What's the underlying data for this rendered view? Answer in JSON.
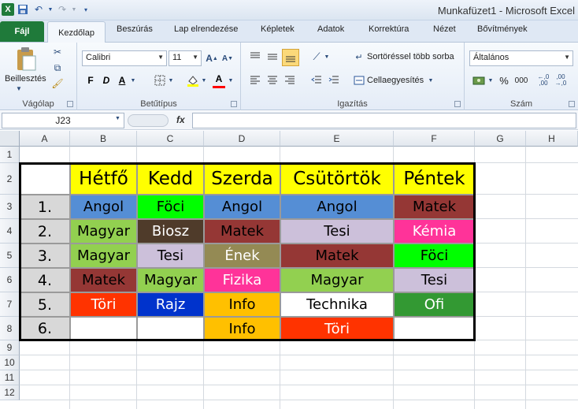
{
  "window": {
    "title": "Munkafüzet1  -  Microsoft Excel"
  },
  "tabs": [
    "Fájl",
    "Kezdőlap",
    "Beszúrás",
    "Lap elrendezése",
    "Képletek",
    "Adatok",
    "Korrektúra",
    "Nézet",
    "Bővítmények"
  ],
  "ribbon": {
    "clipboard": {
      "paste_label": "Beillesztés",
      "group_label": "Vágólap"
    },
    "font": {
      "font_name": "Calibri",
      "font_size": "11",
      "group_label": "Betűtípus",
      "bold": "F",
      "italic": "D",
      "underline": "A"
    },
    "alignment": {
      "wrap_label": "Sortöréssel több sorba",
      "merge_label": "Cellaegyesítés",
      "group_label": "Igazítás"
    },
    "number": {
      "format": "Általános",
      "percent": "%",
      "thousands": "000",
      "group_label": "Szám"
    }
  },
  "formula_bar": {
    "name_box": "J23",
    "fx": "fx",
    "value": ""
  },
  "columns": [
    "A",
    "B",
    "C",
    "D",
    "E",
    "F",
    "G",
    "H"
  ],
  "rows": [
    "1",
    "2",
    "3",
    "4",
    "5",
    "6",
    "7",
    "8",
    "9",
    "10",
    "11",
    "12"
  ],
  "timetable": {
    "days": [
      "Hétfő",
      "Kedd",
      "Szerda",
      "Csütörtök",
      "Péntek"
    ],
    "periods": [
      "1.",
      "2.",
      "3.",
      "4.",
      "5.",
      "6."
    ],
    "cells": [
      [
        {
          "t": "Angol",
          "bg": "#558ed5",
          "fg": "#000"
        },
        {
          "t": "Föci",
          "bg": "#00ff00",
          "fg": "#000"
        },
        {
          "t": "Angol",
          "bg": "#558ed5",
          "fg": "#000"
        },
        {
          "t": "Angol",
          "bg": "#558ed5",
          "fg": "#000"
        },
        {
          "t": "Matek",
          "bg": "#953735",
          "fg": "#000"
        }
      ],
      [
        {
          "t": "Magyar",
          "bg": "#92d050",
          "fg": "#000"
        },
        {
          "t": "Biosz",
          "bg": "#4f3b2a",
          "fg": "#fff"
        },
        {
          "t": "Matek",
          "bg": "#953735",
          "fg": "#000"
        },
        {
          "t": "Tesi",
          "bg": "#ccc0da",
          "fg": "#000"
        },
        {
          "t": "Kémia",
          "bg": "#ff3399",
          "fg": "#fff"
        }
      ],
      [
        {
          "t": "Magyar",
          "bg": "#92d050",
          "fg": "#000"
        },
        {
          "t": "Tesi",
          "bg": "#ccc0da",
          "fg": "#000"
        },
        {
          "t": "Ének",
          "bg": "#948a54",
          "fg": "#fff"
        },
        {
          "t": "Matek",
          "bg": "#953735",
          "fg": "#000"
        },
        {
          "t": "Föci",
          "bg": "#00ff00",
          "fg": "#000"
        }
      ],
      [
        {
          "t": "Matek",
          "bg": "#953735",
          "fg": "#000"
        },
        {
          "t": "Magyar",
          "bg": "#92d050",
          "fg": "#000"
        },
        {
          "t": "Fizika",
          "bg": "#ff3399",
          "fg": "#fff"
        },
        {
          "t": "Magyar",
          "bg": "#92d050",
          "fg": "#000"
        },
        {
          "t": "Tesi",
          "bg": "#ccc0da",
          "fg": "#000"
        }
      ],
      [
        {
          "t": "Töri",
          "bg": "#ff3300",
          "fg": "#fff"
        },
        {
          "t": "Rajz",
          "bg": "#0033cc",
          "fg": "#fff"
        },
        {
          "t": "Info",
          "bg": "#ffc000",
          "fg": "#000"
        },
        {
          "t": "Technika",
          "bg": "#ffffff",
          "fg": "#000"
        },
        {
          "t": "Ofi",
          "bg": "#339933",
          "fg": "#fff"
        }
      ],
      [
        {
          "t": "",
          "bg": "#ffffff",
          "fg": "#000"
        },
        {
          "t": "",
          "bg": "#ffffff",
          "fg": "#000"
        },
        {
          "t": "Info",
          "bg": "#ffc000",
          "fg": "#000"
        },
        {
          "t": "Töri",
          "bg": "#ff3300",
          "fg": "#fff"
        },
        {
          "t": "",
          "bg": "#ffffff",
          "fg": "#000"
        }
      ]
    ]
  }
}
